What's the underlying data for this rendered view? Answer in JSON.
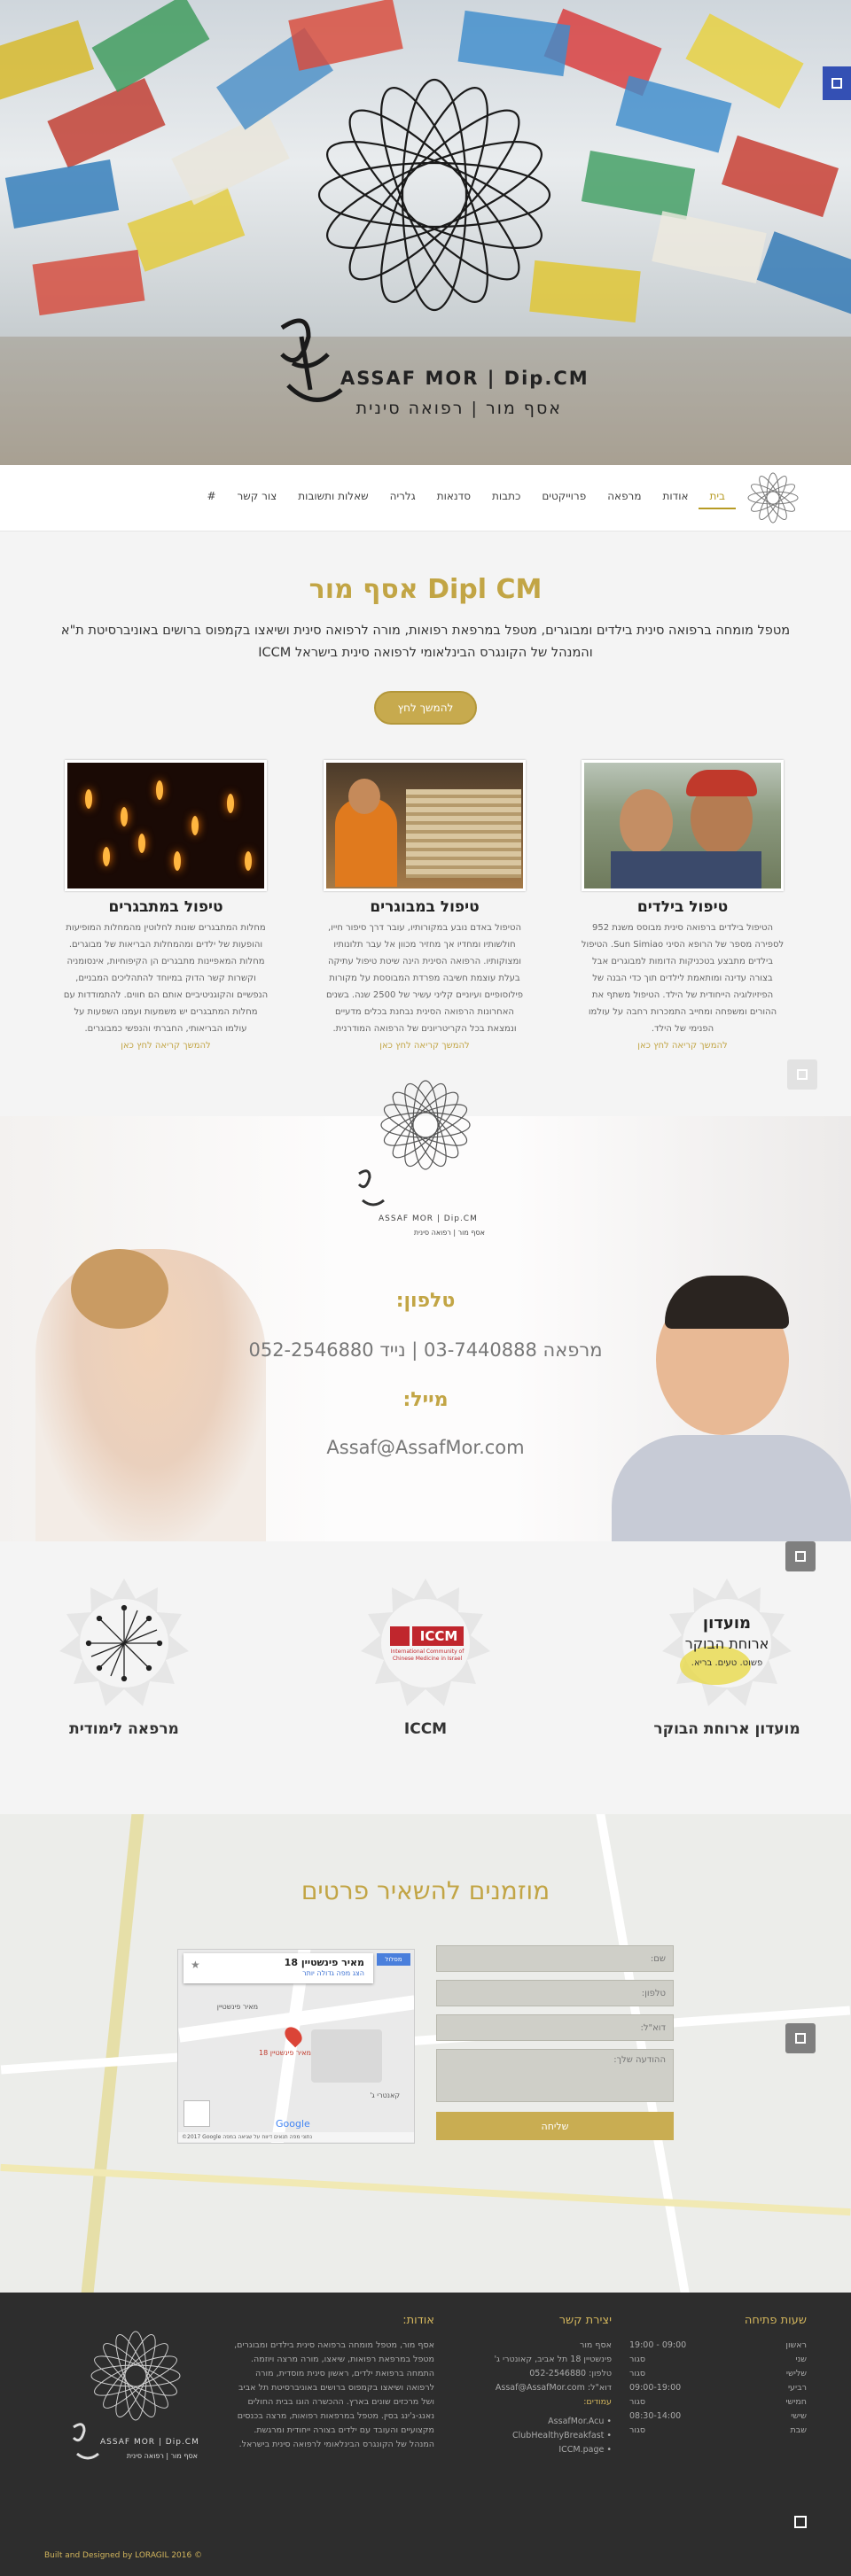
{
  "hero": {
    "logo_latin": "ASSAF MOR | Dip.CM",
    "logo_hebrew": "אסף מור | רפואה סינית"
  },
  "nav": {
    "items": [
      "בית",
      "אודות",
      "מרפאה",
      "פרוייקטים",
      "כתבות",
      "סדנאות",
      "גלריה",
      "שאלות ותשובות",
      "צור קשר",
      "#"
    ]
  },
  "intro": {
    "title": "אסף מור Dipl CM",
    "text": "מטפל מומחה ברפואה סינית בילדים ומבוגרים, מטפל במרפאת רפואות, מורה לרפואה סינית ושיאצו בקמפוס ברושים באוניברסיטת ת\"א והמנהל של הקונגרס הבינלאומי לרפואה סינית בישראל ICCM",
    "button": "להמשך לחץ"
  },
  "cards": [
    {
      "title": "טיפול בילדים",
      "text": "הטיפול בילדים ברפואה סינית מבוסס משנת 952 לספירה מספר של הרופא הסיני Sun Simiao. הטיפול בילדים מתבצע בטכניקות הדומות למבוגרים אבל בצורה עדינה ומותאמת לילדים תוך כדי הבנה של הפיזיולוגיה הייחודית של הילד. הטיפול משתף את ההורים ומשפחה ומחייב התמכרות רחבה על עולמו הפנימי של הילד.",
      "link": "להמשך קריאה לחץ כאן"
    },
    {
      "title": "טיפול במבוגרים",
      "text": "הטיפול באדם נובע במקורותיו, עובר דרך סיפור חייו, חולשותיו ומחדיו אך מחזיר מכוון אל עבר תלונותיו ומצוקותיו. הרפואה הסינית הינה שיטת טיפול עתיקה בעלת עוצמת חשיבה מפרדת המבוססת על מקורות פילוסופיים ועיוניים קליני עשיר של 2500 שנה. בשנים האחרונות הרפואה הסינית נבחנת בכלים מדעיים ונמצאת בכל הקריטריונים של הרפואה המודרנית.",
      "link": "להמשך קריאה לחץ כאן"
    },
    {
      "title": "טיפול במתבגרים",
      "text": "מחלות המתבגרים שונות לחלוטין מהמחלות המופיעות והופעות של ילדים ומהמחלות הבריאות של מבוגרים. מחלות המאפיינות מתבגרים הן הקיפוחיות, אינסומניה וקשרות קשר הדוק במיוחד להתהליכים המבניים, הנפשיים והקוגניטיביים אותם הם חווים. להתמודדות עם מחלות המתבגרים יש משמעות ועמנו השפעות על עולמו הבריאותי, החברתי והנפשי כמבוגרים.",
      "link": "להמשך קריאה לחץ כאן"
    }
  ],
  "contact": {
    "logo_latin": "ASSAF MOR | Dip.CM",
    "logo_hebrew": "אסף מור | רפואה סינית",
    "phone_title": "טלפון:",
    "phone_value": "מרפאה 03-7440888 | נייד 052-2546880",
    "mail_title": "מייל:",
    "mail_value": "Assaf@AssafMor.com"
  },
  "partners": [
    {
      "title": "מועדון ארוחת הבוקר",
      "badge_top": "מועדון",
      "badge_mid": "ארוחת הבוקר",
      "badge_sub": "פשוט. טעים. בריא."
    },
    {
      "title": "ICCM",
      "badge_top": "ICCM",
      "badge_sub": "International Community of Chinese Medicine in Israel"
    },
    {
      "title": "מרפאה לימודית"
    }
  ],
  "form": {
    "title": "מוזמנים להשאיר פרטים",
    "name_ph": "שם:",
    "phone_ph": "טלפון:",
    "email_ph": "דוא\"ל:",
    "message_ph": "ההודעה שלך:",
    "send": "שליחה",
    "map_place": "מאיר פינשטיין 18",
    "map_link": "הצג מפה גדולה יותר",
    "map_dir": "מסלול",
    "map_pin": "מאיר פינשטיין 18",
    "map_street": "מאיר פינשטיין",
    "map_store": "קאנטרי ג'",
    "map_footer": "©2017 Google  נתוני מפה  תנאים  דיווח על שגיאה במפה",
    "map_brand": "Google"
  },
  "footer": {
    "hours_title": "שעות פתיחה",
    "hours": [
      {
        "day": "ראשון",
        "time": "19:00 - 09:00"
      },
      {
        "day": "שני",
        "time": "סגור"
      },
      {
        "day": "שלישי",
        "time": "סגור"
      },
      {
        "day": "רביעי",
        "time": "09:00-19:00"
      },
      {
        "day": "חמישי",
        "time": "סגור"
      },
      {
        "day": "שישי",
        "time": "08:30-14:00"
      },
      {
        "day": "שבת",
        "time": "סגור"
      }
    ],
    "contact_title": "יצירת קשר",
    "contact_lines": [
      "אסף מור",
      "פינשטיין 18 תל אביב, קאונטרי ג'",
      "טלפון: 052-2546880",
      "דוא\"ל: Assaf@AssafMor.com",
      "עמודים:"
    ],
    "contact_links": [
      "AssafMor.Acu",
      "ClubHealthyBreakfast",
      "ICCM.page"
    ],
    "about_title": "אודות:",
    "about_text": "אסף מור, מטפל מומחה ברפואה סינית בילדים ומבוגרים, מטפל במרפאת רפואות, שיאצו, מורה מרצה ויוזמה. התמחה ברפואת ילדים, ראשון סינית מוסדית, מורה לרפואה ושיאצו בקמפוס ברושים באוניברסיטת תל אביב ושל מרכזים שונים בארץ. ההכשרה הוגו בבית החולים נאנג-ג'ינג בסין. מטפל במרפאות רפואות, מרצה בכנסים מקצועיים והעובד עם ילדים בצורה ייחודית ומרגשת. המנהל של הקונגרס הבינלאומי לרפואה סינית בישראל.",
    "logo_latin": "ASSAF MOR | Dip.CM",
    "logo_hebrew": "אסף מור | רפואה סינית",
    "credit": "Built and Designed by LORAGIL 2016 ©"
  }
}
